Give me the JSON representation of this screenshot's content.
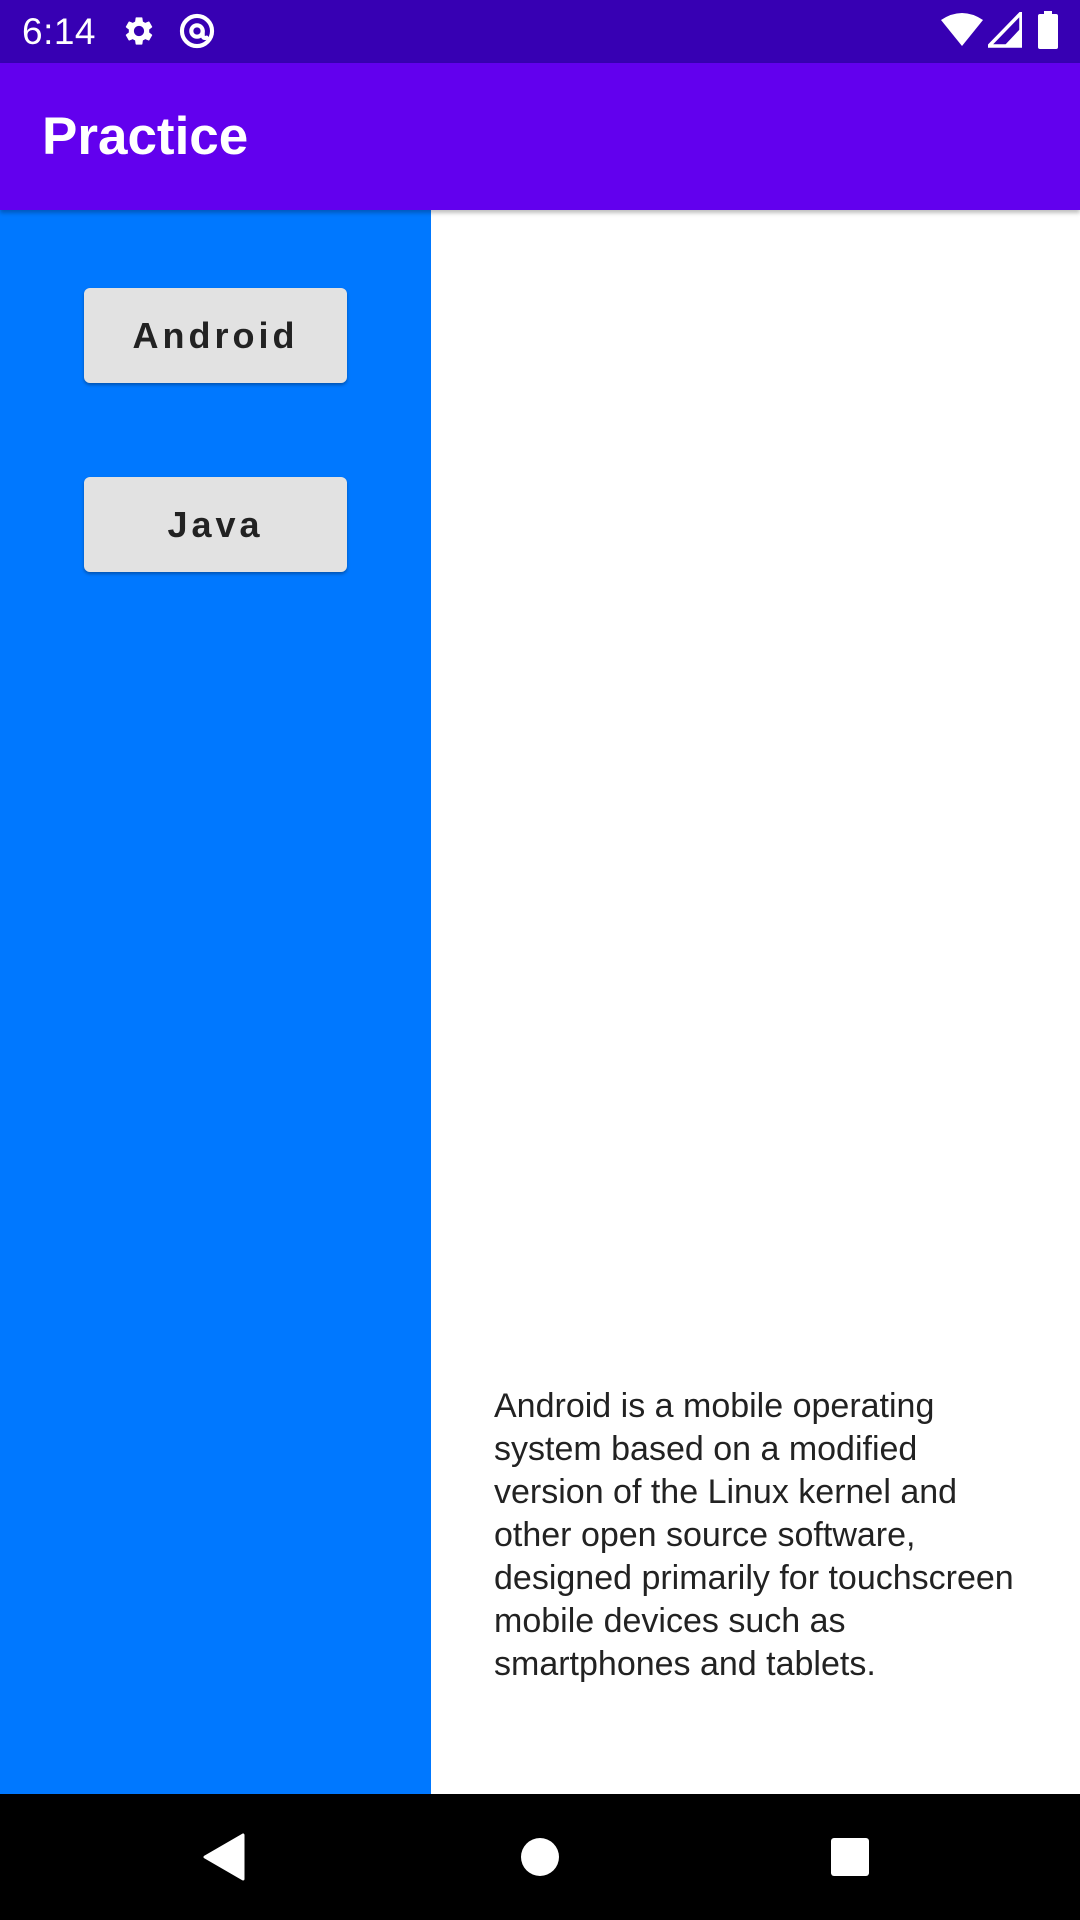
{
  "status_bar": {
    "time": "6:14",
    "background_color": "#3700b3",
    "icons": [
      "settings-gear-icon",
      "at-sign-icon",
      "wifi-icon",
      "cell-signal-icon",
      "battery-icon"
    ]
  },
  "app_bar": {
    "title": "Practice",
    "background_color": "#6200ee"
  },
  "sidebar": {
    "background_color": "#0078ff",
    "buttons": [
      {
        "label": "Android"
      },
      {
        "label": "Java"
      }
    ]
  },
  "detail": {
    "text": "Android is a mobile operating system based on a modified version of the Linux kernel and other open source software, designed primarily for touchscreen mobile devices such as smartphones and tablets."
  },
  "nav_bar": {
    "icons": [
      "back-icon",
      "home-icon",
      "recents-icon"
    ]
  }
}
